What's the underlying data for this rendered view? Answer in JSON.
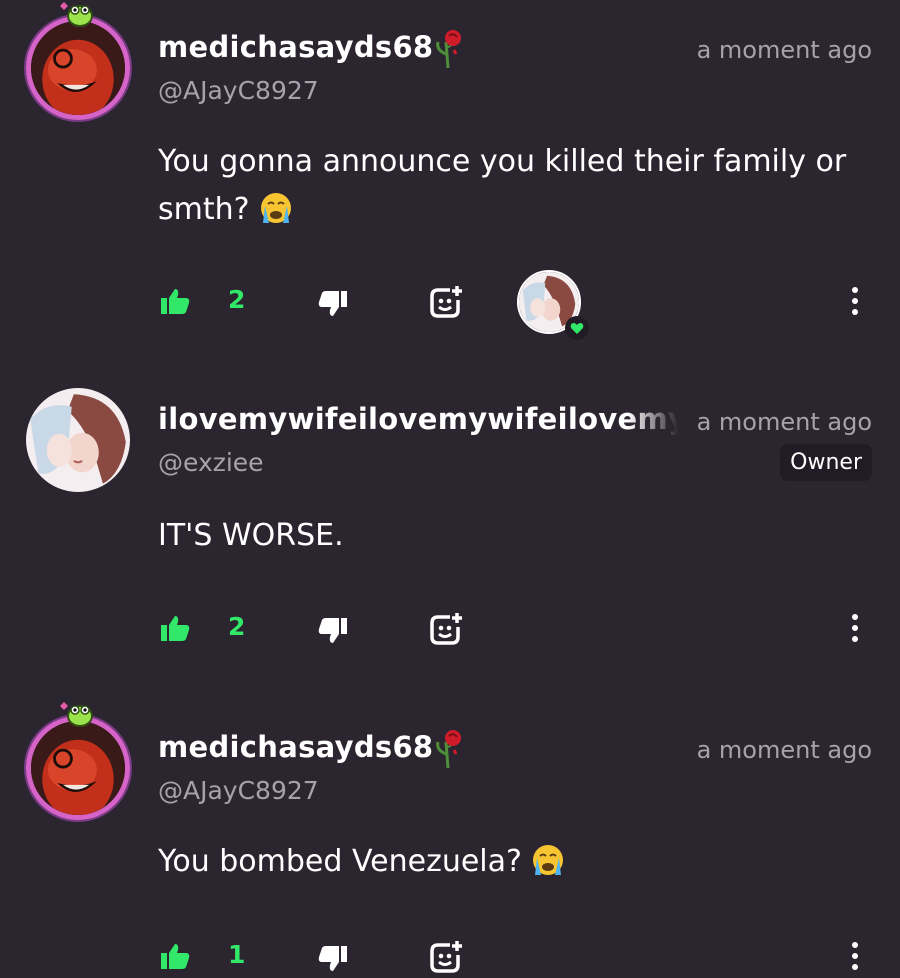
{
  "comments": [
    {
      "display_name": "medichasayds68",
      "handle": "@AJayC8927",
      "timestamp": "a moment ago",
      "text": "You gonna announce you killed their family or smth?",
      "emoji": "loudly-crying-face",
      "likes": "2",
      "avatar_icon": "red-character-avatar",
      "has_frame": true,
      "name_icon": "wilted-rose-icon",
      "reactor": true
    },
    {
      "display_name": "ilovemywifeilovemywifeilovemyw",
      "handle": "@exziee",
      "timestamp": "a moment ago",
      "badge": "Owner",
      "text": "IT'S WORSE.",
      "likes": "2",
      "avatar_icon": "anime-couple-avatar",
      "has_frame": false
    },
    {
      "display_name": "medichasayds68",
      "handle": "@AJayC8927",
      "timestamp": "a moment ago",
      "text": "You bombed Venezuela?",
      "emoji": "loudly-crying-face",
      "likes": "1",
      "avatar_icon": "red-character-avatar",
      "has_frame": true,
      "name_icon": "wilted-rose-icon"
    }
  ],
  "colors": {
    "background": "#2b2530",
    "accent_green": "#31e868",
    "muted_text": "#a7a1ab",
    "frame_pink": "#d664c8"
  }
}
